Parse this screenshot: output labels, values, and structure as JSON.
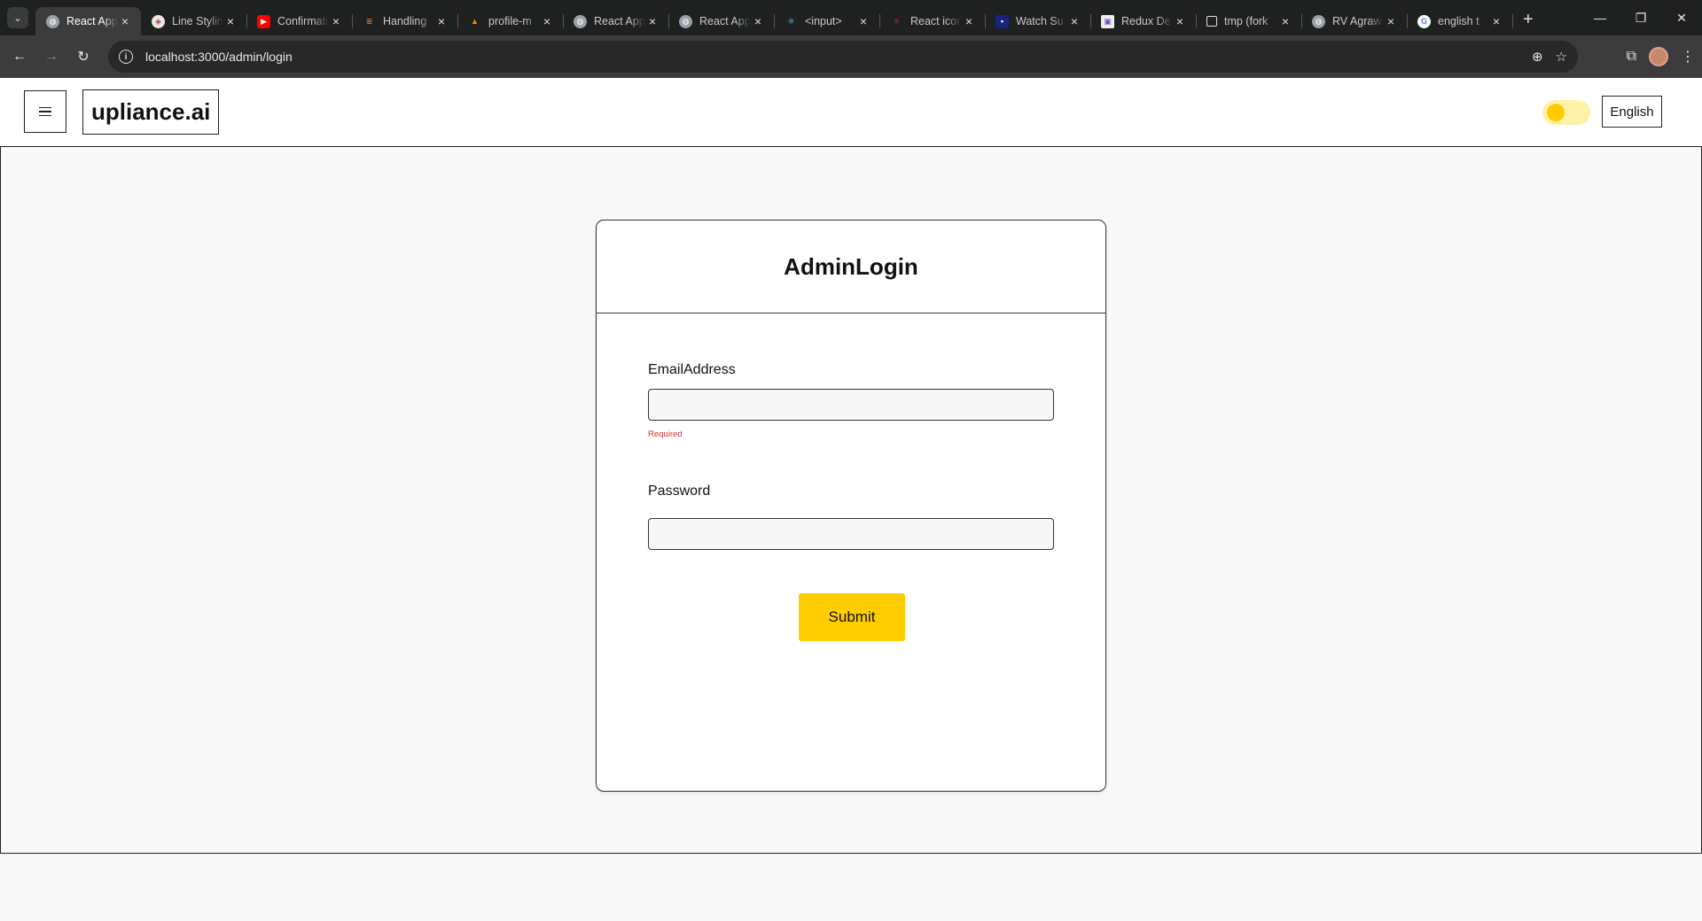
{
  "browser": {
    "tabs": [
      {
        "label": "React App",
        "favicon": "globe-icon",
        "active": true
      },
      {
        "label": "Line Styling",
        "favicon": "cube-icon"
      },
      {
        "label": "Confirmation",
        "favicon": "youtube-icon"
      },
      {
        "label": "Handling",
        "favicon": "stackoverflow-icon"
      },
      {
        "label": "profile-m",
        "favicon": "firebase-icon"
      },
      {
        "label": "React App",
        "favicon": "globe-icon"
      },
      {
        "label": "React App",
        "favicon": "globe-icon"
      },
      {
        "label": "<input>",
        "favicon": "react-icon"
      },
      {
        "label": "React icons",
        "favicon": "react-icons-icon"
      },
      {
        "label": "Watch Su",
        "favicon": "video-icon"
      },
      {
        "label": "Redux De",
        "favicon": "redux-icon"
      },
      {
        "label": "tmp (fork",
        "favicon": "square-icon"
      },
      {
        "label": "RV Agrawal",
        "favicon": "globe-icon"
      },
      {
        "label": "english t",
        "favicon": "google-icon"
      }
    ],
    "url": "localhost:3000/admin/login"
  },
  "header": {
    "brand": "upliance.ai",
    "language": "English",
    "theme_toggle_on": true,
    "accent_color": "#ffcc00"
  },
  "login": {
    "title": "AdminLogin",
    "email_label": "EmailAddress",
    "email_value": "",
    "email_error": "Required",
    "password_label": "Password",
    "password_value": "",
    "submit_label": "Submit"
  }
}
